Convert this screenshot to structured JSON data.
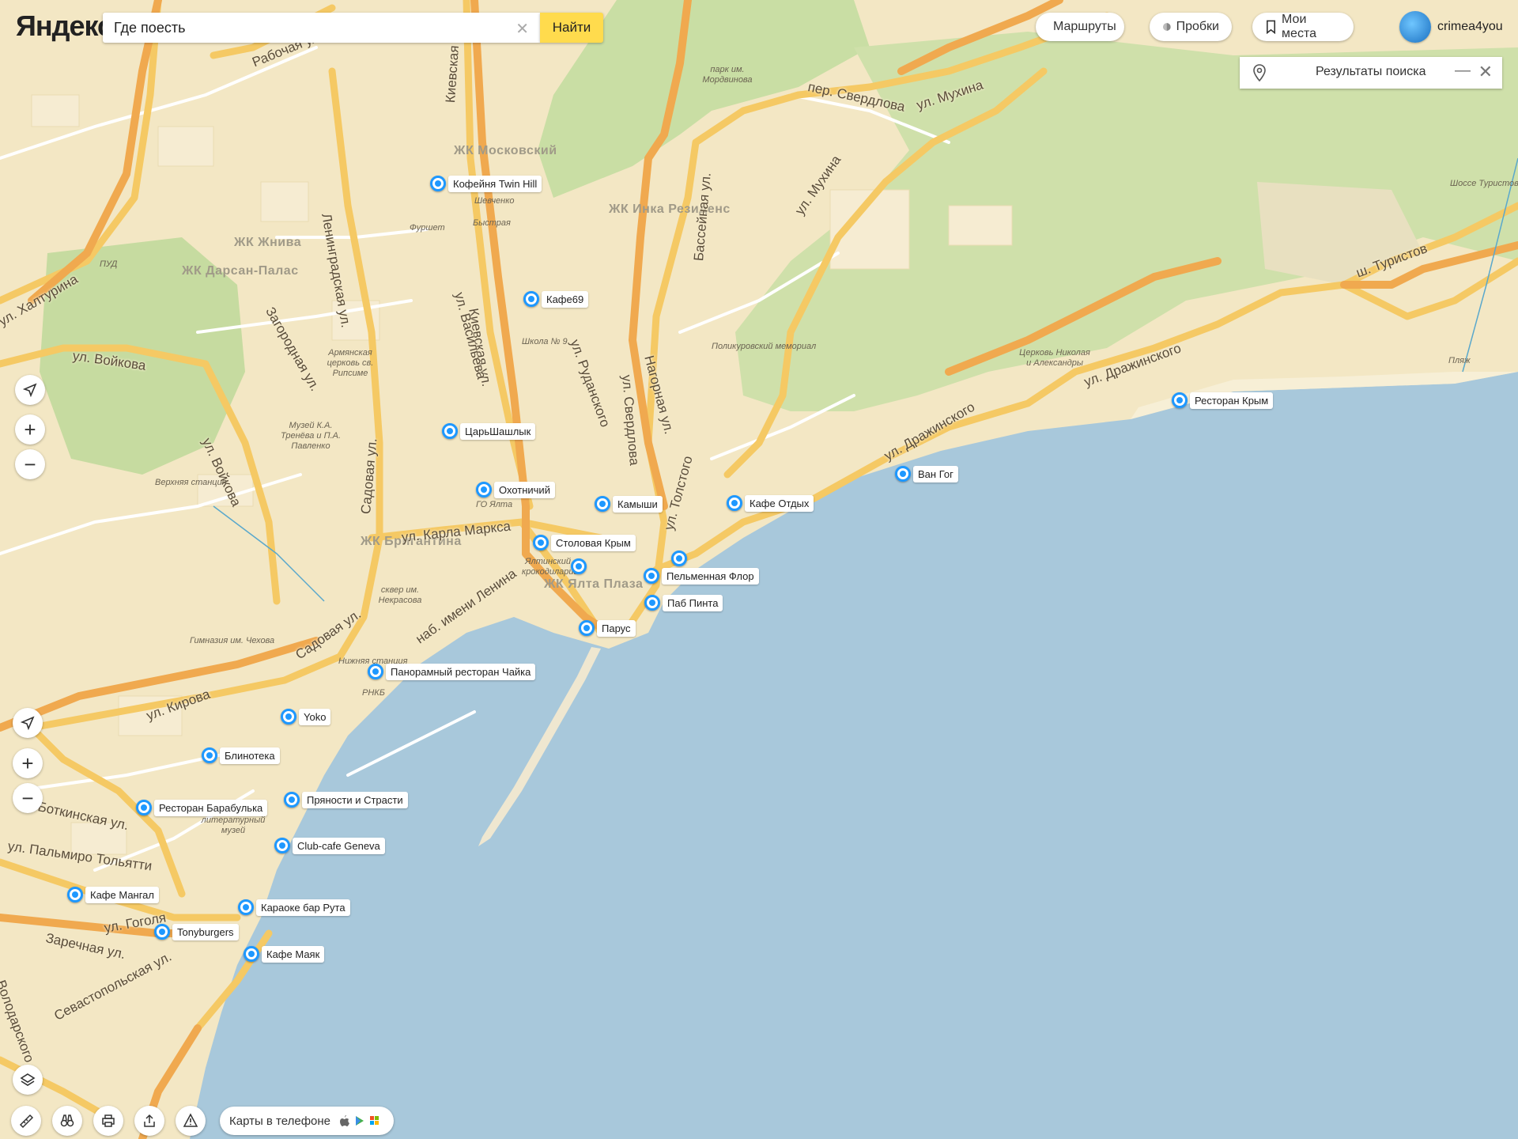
{
  "header": {
    "logo": "Яндекс",
    "search_value": "Где поесть",
    "search_button": "Найти",
    "routes": "Маршруты",
    "traffic": "Пробки",
    "my_places": "Мои места",
    "user": "crimea4you"
  },
  "results_panel": {
    "title": "Результаты поиска"
  },
  "controls": {
    "zoom_in": "+",
    "zoom_out": "−"
  },
  "footer": {
    "phone_maps": "Карты в телефоне"
  },
  "map": {
    "districts": [
      "ЖК Московский",
      "ЖК Инка Резиденс",
      "ЖК Жнива",
      "ЖК Дарсан-Палас",
      "ЖК Бригантина",
      "ЖК Ялта Плаза"
    ],
    "streets": [
      "Рабочая ул.",
      "Киевская ул.",
      "Киевская ул.",
      "ул. Войкова",
      "ул. Войкова",
      "ул. Карла Маркса",
      "Садовая ул.",
      "Садовая ул.",
      "ул. Кирова",
      "ул. Свердлова",
      "ул. Мухина",
      "ул. Мухина",
      "ул. Дражинского",
      "ул. Дражинского",
      "ул. Руданского",
      "Ботки­нская ул.",
      "ул. Гоголя",
      "ул. Пальмиро Тольятти",
      "наб. имени Ленина",
      "Ленинградская ул.",
      "ш. Туристов",
      "Бассейная ул.",
      "Нагорная ул.",
      "ул. Толстого",
      "пер. Свердлова",
      "ул. Халтурина",
      "Загородная ул.",
      "ул. Васильева",
      "Заречная ул.",
      "Севастопольская ул.",
      "Володарского"
    ],
    "labels": [
      "парк им. Мордвинова",
      "Поликуровский мемориал",
      "Армянская церковь св. Рипсиме",
      "Музей К.А. Тренёва и П.А. Павленко",
      "Верхняя станция",
      "Школа № 9",
      "ГО Ялта",
      "сквер им. Некрасова",
      "Гимназия им. Чехова",
      "Нижняя станция",
      "РНКБ",
      "историко-литературный музей",
      "Церковь Николая и Александры",
      "Шоссе Туристов",
      "Фуршет",
      "ПУД",
      "Шевченко",
      "Быстрая",
      "Ялтинский крокодиларий",
      "Пляж"
    ],
    "places": [
      {
        "name": "Кофейня Twin Hill"
      },
      {
        "name": "Кафе69"
      },
      {
        "name": "ЦарьШашлык"
      },
      {
        "name": "Охотничий"
      },
      {
        "name": "Камыши"
      },
      {
        "name": "Кафе Отдых"
      },
      {
        "name": "Столовая Крым"
      },
      {
        "name": ""
      },
      {
        "name": ""
      },
      {
        "name": "Пельменная Флор"
      },
      {
        "name": "Паб Пинта"
      },
      {
        "name": "Парус"
      },
      {
        "name": "Ван Гог"
      },
      {
        "name": "Ресторан Крым"
      },
      {
        "name": "Панорамный ресторан Чайка"
      },
      {
        "name": "Yoko"
      },
      {
        "name": "Блинотека"
      },
      {
        "name": "Ресторан Барабулька"
      },
      {
        "name": "Пряности и Страсти"
      },
      {
        "name": "Club-cafe Geneva"
      },
      {
        "name": "Кафе Мангал"
      },
      {
        "name": "Караоке бар Рута"
      },
      {
        "name": "Tonyburgers"
      },
      {
        "name": "Кафе Маяк"
      }
    ]
  }
}
